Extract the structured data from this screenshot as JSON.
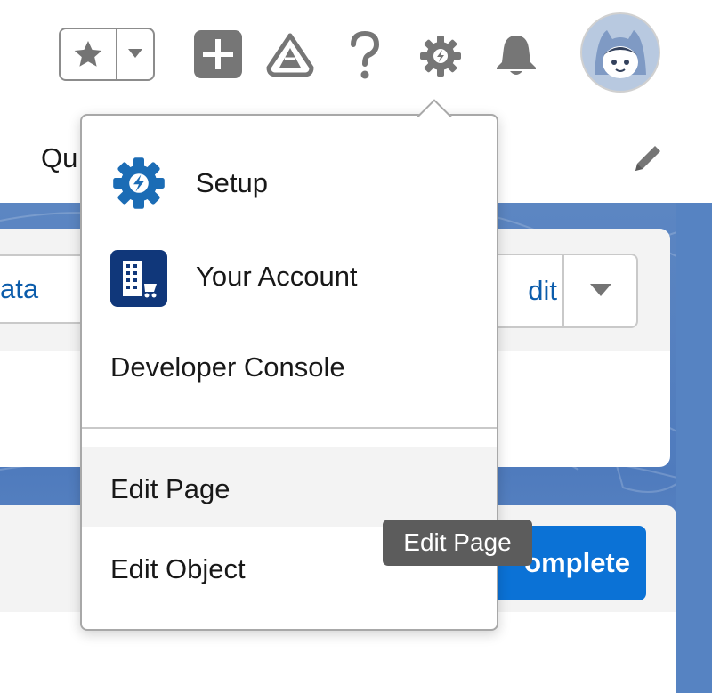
{
  "header": {
    "favorites_star_icon": "star-icon",
    "favorites_caret_icon": "chevron-down-icon",
    "global_actions_icon": "plus-icon",
    "guidance_icon": "trailhead-icon",
    "help_icon": "question-icon",
    "setup_icon": "gear-icon",
    "notifications_icon": "bell-icon",
    "avatar_icon": "astro-avatar-icon"
  },
  "tabbar": {
    "partial_tab_label": "Qu"
  },
  "page": {
    "data_button_label": "ata",
    "edit_button_label": "dit",
    "complete_button_label": "omplete"
  },
  "menu": {
    "items": [
      {
        "label": "Setup",
        "icon": "setup-gear-icon"
      },
      {
        "label": "Your Account",
        "icon": "account-building-icon"
      },
      {
        "label": "Developer Console"
      },
      {
        "label": "Edit Page"
      },
      {
        "label": "Edit Object"
      }
    ]
  },
  "tooltip": {
    "text": "Edit Page"
  },
  "colors": {
    "brand_blue": "#0b72d6",
    "link_blue": "#0b5cab",
    "setup_icon_blue": "#1b6cb5",
    "account_icon_bg": "#10377a",
    "page_background": "#5683c2"
  }
}
